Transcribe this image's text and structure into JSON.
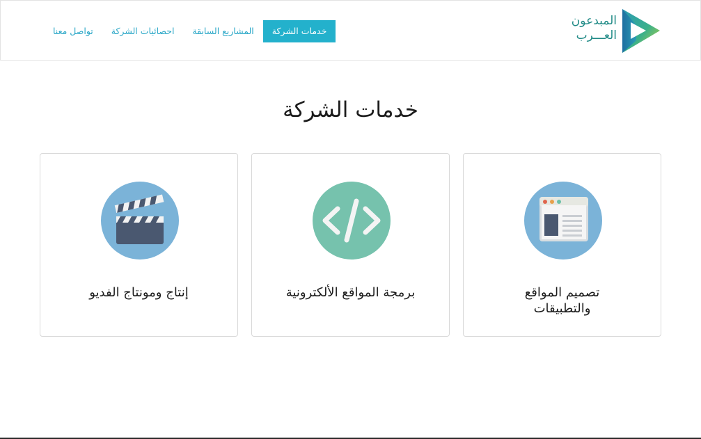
{
  "header": {
    "logo": {
      "line1": "المبدعون",
      "line2": "العـــرب",
      "icon": "play-triangle-logo"
    },
    "nav": [
      {
        "label": "خدمات الشركة",
        "active": true
      },
      {
        "label": "المشاريع السابقة",
        "active": false
      },
      {
        "label": "احصائيات الشركة",
        "active": false
      },
      {
        "label": "تواصل معنا",
        "active": false
      }
    ]
  },
  "main": {
    "title": "خدمات الشركة",
    "services": [
      {
        "label": "تصميم المواقع والتطبيقات",
        "icon": "browser-window-icon"
      },
      {
        "label": "برمجة المواقع الألكترونية",
        "icon": "code-brackets-icon"
      },
      {
        "label": "إنتاج ومونتاج الفديو",
        "icon": "clapperboard-icon"
      }
    ]
  },
  "colors": {
    "accent": "#23b1cc",
    "nav_text": "#2aa7c7",
    "logo_text": "#1f8a86",
    "icon_blue": "#7bb3d8",
    "icon_green": "#76c2ad"
  }
}
